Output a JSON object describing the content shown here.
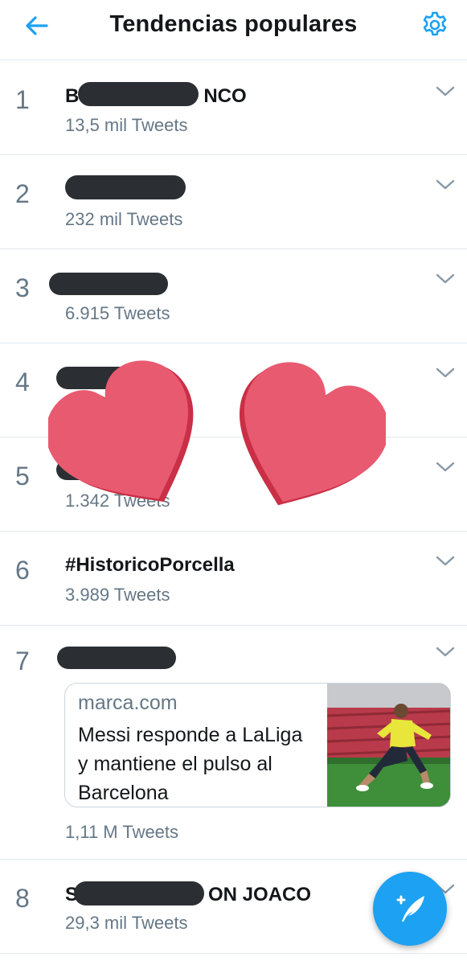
{
  "header": {
    "title": "Tendencias populares",
    "back_icon": "arrow-left-icon",
    "settings_icon": "gear-icon",
    "accent": "#1da1f2"
  },
  "trends": [
    {
      "rank": "1",
      "name_visible_start": "B",
      "name_visible_end": "NCO",
      "count": "13,5 mil Tweets"
    },
    {
      "rank": "2",
      "count": "232 mil Tweets"
    },
    {
      "rank": "3",
      "count": "6.915 Tweets"
    },
    {
      "rank": "4",
      "count": ""
    },
    {
      "rank": "5",
      "count": "1.342 Tweets"
    },
    {
      "rank": "6",
      "name": "#HistoricoPorcella",
      "count": "3.989 Tweets"
    },
    {
      "rank": "7",
      "count": "1,11 M Tweets",
      "card": {
        "domain": "marca.com",
        "text": "Messi responde a LaLiga y mantiene el pulso al Barcelona"
      }
    },
    {
      "rank": "8",
      "name_visible_start": "S",
      "name_visible_end": "ON JOACO",
      "count": "29,3 mil Tweets"
    }
  ],
  "fab": {
    "icon": "compose-tweet-icon"
  },
  "overlay": {
    "icon": "heart-sticker-icon",
    "color": "#e85a70"
  }
}
